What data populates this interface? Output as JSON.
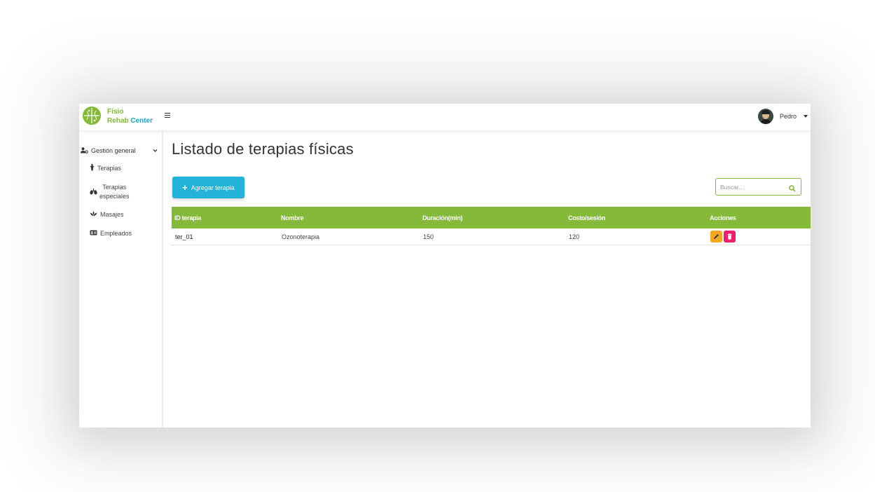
{
  "brand": {
    "line1": "Fisio",
    "line2_a": "Rehab ",
    "line2_b": "Center"
  },
  "user": {
    "name": "Pedro"
  },
  "sidebar": {
    "group_label": "Gestión general",
    "items": [
      {
        "label": "Terapias",
        "icon": "person-icon"
      },
      {
        "label_line1": "Terapias",
        "label_line2": "especiales",
        "icon": "lungs-icon"
      },
      {
        "label": "Masajes",
        "icon": "spa-icon"
      },
      {
        "label": "Empleados",
        "icon": "id-card-icon"
      }
    ]
  },
  "main": {
    "title": "Listado de terapias físicas",
    "add_button_label": "Agregar terapia",
    "search_placeholder": "Buscar..."
  },
  "table": {
    "headers": [
      "ID terapia",
      "Nombre",
      "Duración(min)",
      "Costo/sesión",
      "Acciones"
    ],
    "rows": [
      {
        "id": "ter_01",
        "nombre": "Ozonoterapia",
        "duracion": "150",
        "costo": "120"
      }
    ]
  },
  "colors": {
    "accent_green": "#84b93a",
    "button_blue": "#23b3d8",
    "edit_orange": "#f5a623",
    "delete_pink": "#ef1d6e"
  }
}
